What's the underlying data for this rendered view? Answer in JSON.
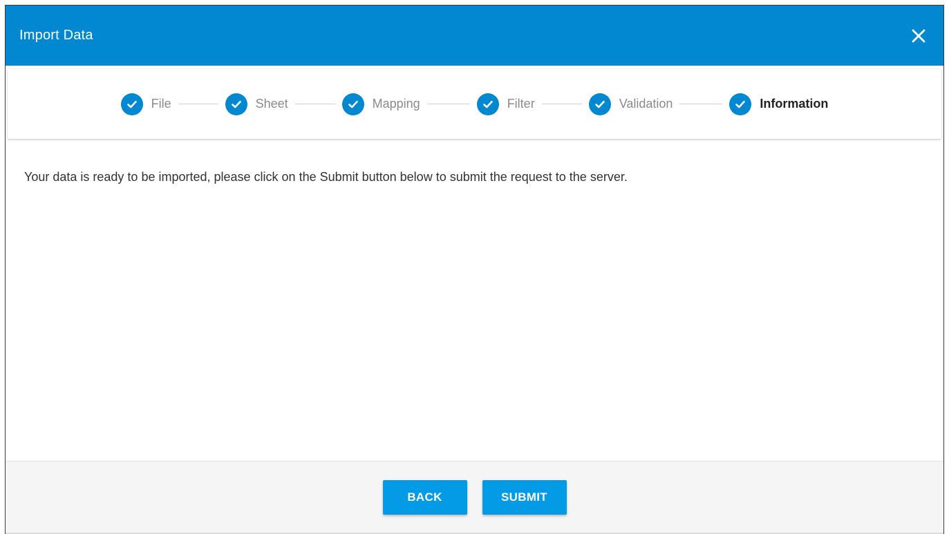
{
  "dialog": {
    "title": "Import Data",
    "close_icon": "close-icon"
  },
  "colors": {
    "header": "#0288d1",
    "step_check": "#0288d1",
    "button": "#039be5",
    "footer": "#f5f5f5"
  },
  "stepper": {
    "steps": [
      {
        "label": "File",
        "state": "completed",
        "icon": "check-icon"
      },
      {
        "label": "Sheet",
        "state": "completed",
        "icon": "check-icon"
      },
      {
        "label": "Mapping",
        "state": "completed",
        "icon": "check-icon"
      },
      {
        "label": "Filter",
        "state": "completed",
        "icon": "check-icon"
      },
      {
        "label": "Validation",
        "state": "completed",
        "icon": "check-icon"
      },
      {
        "label": "Information",
        "state": "active",
        "icon": "check-icon"
      }
    ]
  },
  "content": {
    "message": "Your data is ready to be imported, please click on the Submit button below to submit the request to the server."
  },
  "footer": {
    "back_label": "BACK",
    "submit_label": "SUBMIT"
  }
}
